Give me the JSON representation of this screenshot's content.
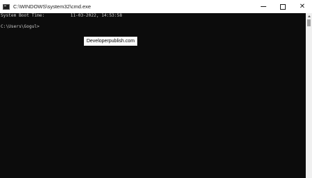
{
  "window": {
    "title": "C:\\WINDOWS\\system32\\cmd.exe",
    "icon": "console-app-icon",
    "controls": {
      "minimize_glyph": "minimize-icon",
      "maximize_glyph": "maximize-icon",
      "close_glyph": "✕"
    }
  },
  "console": {
    "lines": [
      "System Boot Time:          11-03-2022, 14:53:58",
      "",
      "C:\\Users\\Gogul>"
    ]
  },
  "overlay": {
    "label": "Developerpublish.com"
  },
  "colors": {
    "console_bg": "#0c0c0c",
    "console_fg": "#cccccc",
    "titlebar_bg": "#ffffff"
  }
}
